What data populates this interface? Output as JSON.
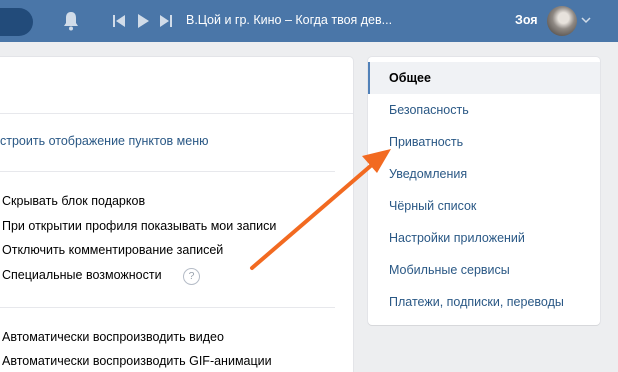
{
  "header": {
    "track": "В.Цой и гр. Кино – Когда твоя дев...",
    "user_name": "Зоя"
  },
  "main": {
    "menu_link": "строить отображение пунктов меню",
    "group1": [
      "Скрывать блок подарков",
      "При открытии профиля показывать мои записи",
      "Отключить комментирование записей",
      "Специальные возможности"
    ],
    "help": "?",
    "group2": [
      "Автоматически воспроизводить видео",
      "Автоматически воспроизводить GIF-анимации"
    ]
  },
  "nav": {
    "items": [
      "Общее",
      "Безопасность",
      "Приватность",
      "Уведомления",
      "Чёрный список",
      "Настройки приложений",
      "Мобильные сервисы",
      "Платежи, подписки, переводы"
    ],
    "active_index": 0
  },
  "colors": {
    "header": "#4a76a8",
    "link": "#2a5885",
    "arrow": "#f26a21"
  },
  "icons": [
    "search-icon",
    "bell-icon",
    "prev-icon",
    "play-icon",
    "next-icon",
    "chevron-down-icon",
    "help-icon",
    "arrow-annotation"
  ]
}
